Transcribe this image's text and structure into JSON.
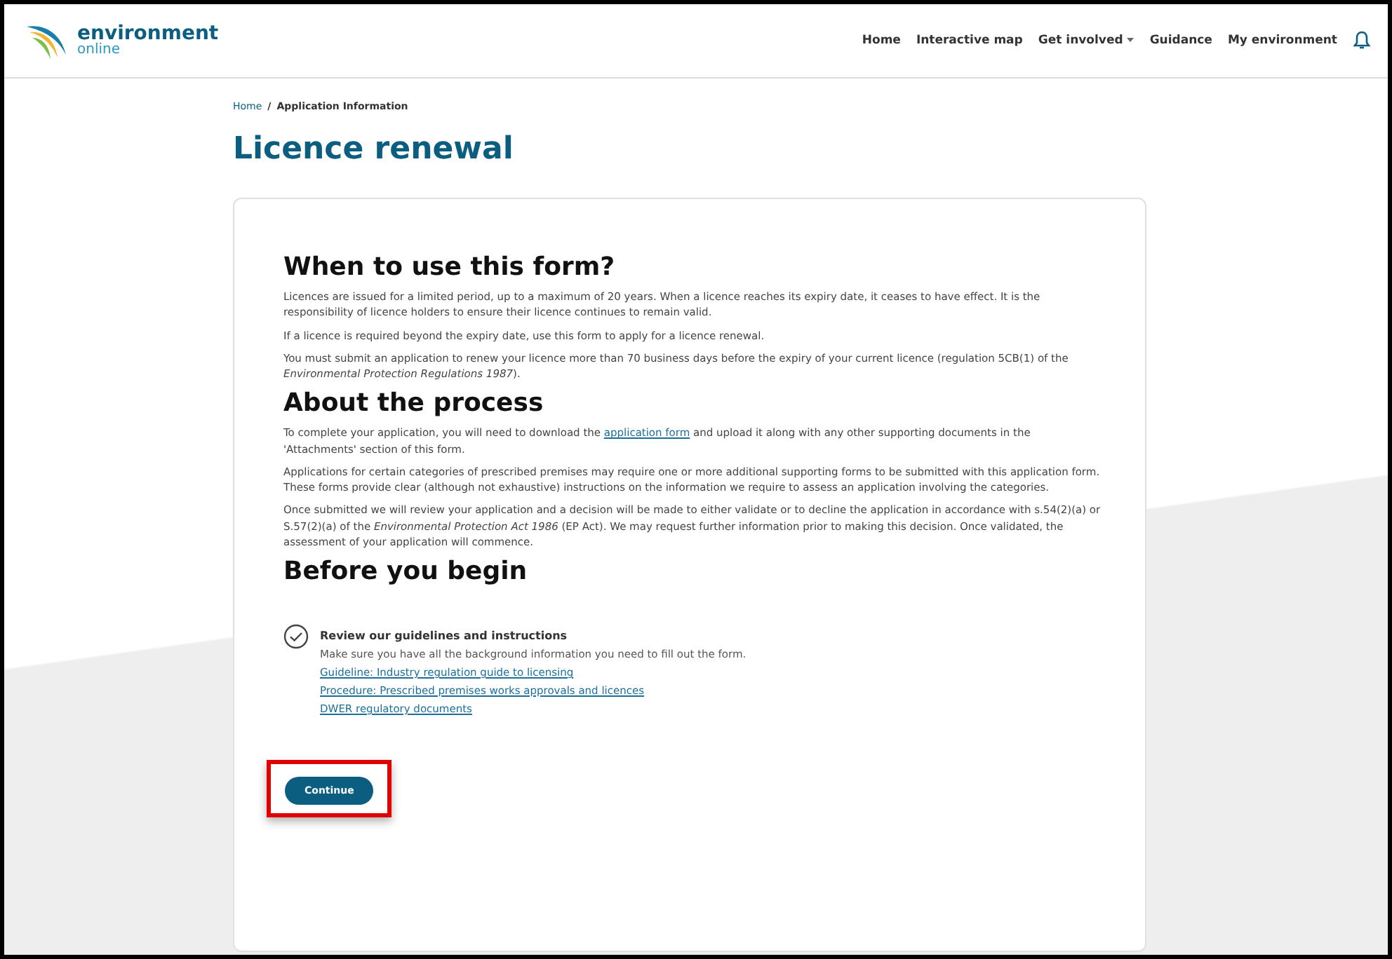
{
  "header": {
    "logo": {
      "name": "environment",
      "sub": "online"
    },
    "nav": [
      {
        "label": "Home",
        "dropdown": false
      },
      {
        "label": "Interactive map",
        "dropdown": false
      },
      {
        "label": "Get involved",
        "dropdown": true
      },
      {
        "label": "Guidance",
        "dropdown": false
      },
      {
        "label": "My environment",
        "dropdown": false
      }
    ]
  },
  "breadcrumb": [
    {
      "label": "Home",
      "current": false
    },
    {
      "label": "Application Information",
      "current": true
    }
  ],
  "breadcrumb_separator": "/",
  "title": "Licence renewal",
  "sections": [
    {
      "heading": "When to use this form?",
      "paragraphs": [
        [
          {
            "kind": "text",
            "text": "Licences are issued for a limited period, up to a maximum of 20 years. When a licence reaches its expiry date, it ceases to have effect. It is the responsibility of licence holders to ensure their licence continues to remain valid."
          }
        ],
        [
          {
            "kind": "text",
            "text": "If a licence is required beyond the expiry date, use this form to apply for a licence renewal."
          }
        ],
        [
          {
            "kind": "text",
            "text": "You must submit an application to renew your licence more than 70 business days before the expiry of your current licence (regulation 5CB(1) of the *Environmental Protection Regulations 1987*)."
          }
        ]
      ]
    },
    {
      "heading": "About the process",
      "paragraphs": [
        [
          {
            "kind": "text",
            "text": "To complete your application, you will need to download the"
          },
          {
            "kind": "link",
            "text": "application form"
          },
          {
            "kind": "text",
            "text": "and upload it along with any other supporting documents in the 'Attachments' section of this form."
          }
        ],
        [
          {
            "kind": "text",
            "text": "Applications for certain categories of prescribed premises may require one or more additional supporting forms to be submitted with this application form. These forms provide clear (although not exhaustive) instructions on the information we require to assess an application involving the categories."
          }
        ],
        [
          {
            "kind": "text",
            "text": "Once submitted we will review your application and a decision will be made to either validate or to decline the application in accordance with s.54(2)(a) or S.57(2)(a) of the *Environmental Protection Act 1986* (EP Act). We may request further information prior to making this decision. Once validated, the assessment of your application will commence."
          }
        ]
      ]
    },
    {
      "heading": "Before you begin"
    }
  ],
  "checklist": [
    {
      "title": "Review our guidelines and instructions",
      "checked": true,
      "description": "Make sure you have all the background information you need to fill out the form.",
      "links": [
        "Guideline: Industry regulation guide to licensing",
        "Procedure: Prescribed premises works approvals and licences",
        "DWER regulatory documents"
      ]
    }
  ],
  "continue_button": {
    "label": "Continue",
    "highlighted": true
  }
}
